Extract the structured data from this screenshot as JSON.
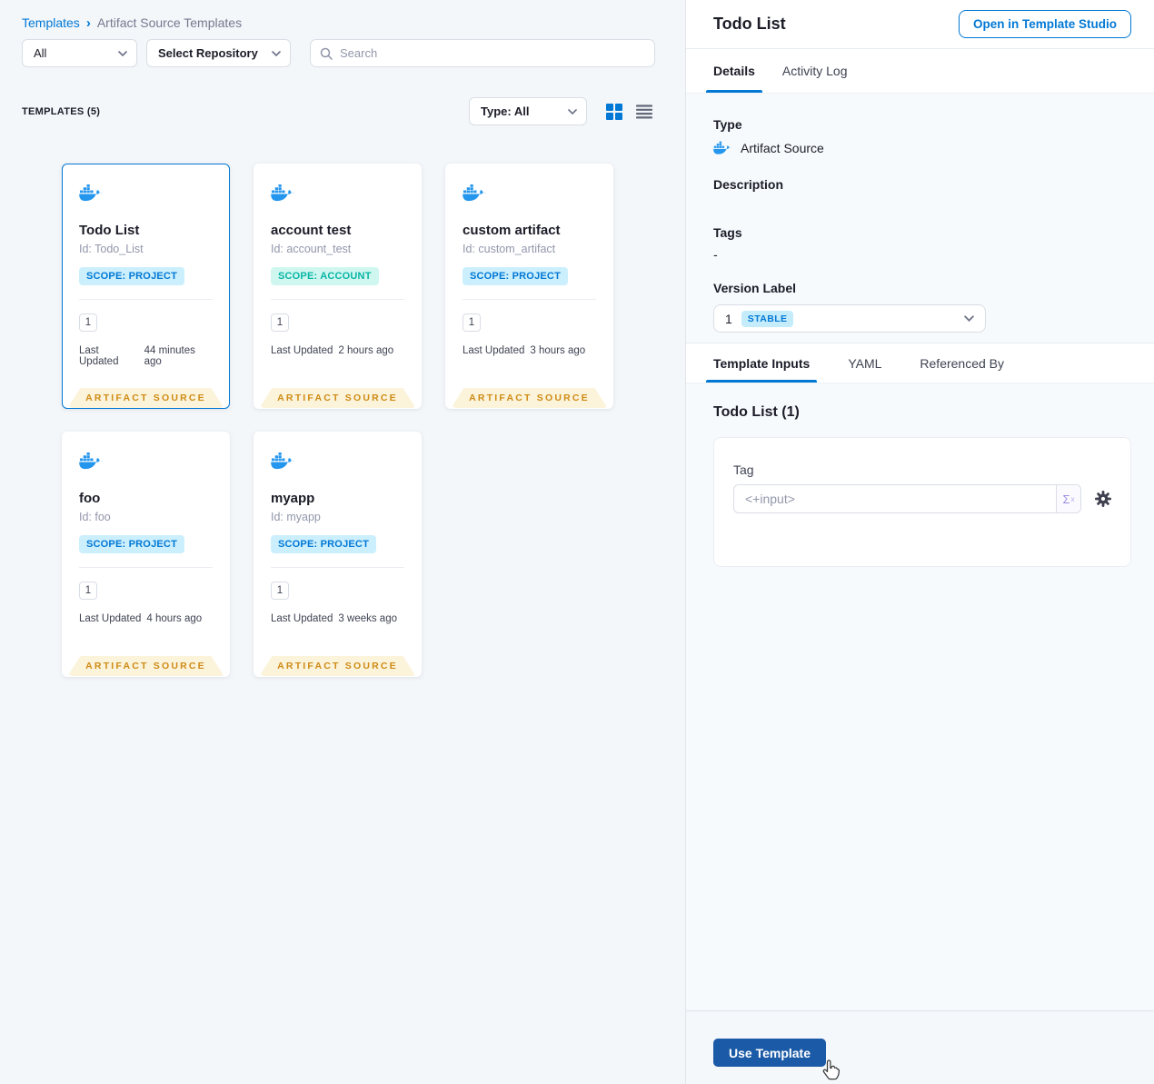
{
  "breadcrumb": {
    "root": "Templates",
    "separator": "›",
    "current": "Artifact Source Templates"
  },
  "filters": {
    "scope": "All",
    "repository": "Select Repository",
    "search_placeholder": "Search"
  },
  "toolbar": {
    "count": "TEMPLATES (5)",
    "type_filter": "Type: All"
  },
  "labels": {
    "last_updated": "Last Updated"
  },
  "cards": [
    {
      "title": "Todo List",
      "id": "Id: Todo_List",
      "scope": "SCOPE: PROJECT",
      "version": "1",
      "updated": "44 minutes ago",
      "type_ribbon": "ARTIFACT SOURCE"
    },
    {
      "title": "account test",
      "id": "Id: account_test",
      "scope": "SCOPE: ACCOUNT",
      "version": "1",
      "updated": "2 hours ago",
      "type_ribbon": "ARTIFACT SOURCE"
    },
    {
      "title": "custom artifact",
      "id": "Id: custom_artifact",
      "scope": "SCOPE: PROJECT",
      "version": "1",
      "updated": "3 hours ago",
      "type_ribbon": "ARTIFACT SOURCE"
    },
    {
      "title": "foo",
      "id": "Id: foo",
      "scope": "SCOPE: PROJECT",
      "version": "1",
      "updated": "4 hours ago",
      "type_ribbon": "ARTIFACT SOURCE"
    },
    {
      "title": "myapp",
      "id": "Id: myapp",
      "scope": "SCOPE: PROJECT",
      "version": "1",
      "updated": "3 weeks ago",
      "type_ribbon": "ARTIFACT SOURCE"
    }
  ],
  "panel": {
    "title": "Todo List",
    "open_button": "Open in Template Studio",
    "tabs": {
      "details": "Details",
      "activity": "Activity Log"
    },
    "fields": {
      "type_label": "Type",
      "type_value": "Artifact Source",
      "description_label": "Description",
      "tags_label": "Tags",
      "tags_value": "-",
      "version_label": "Version Label",
      "version_value": "1",
      "version_badge": "STABLE"
    },
    "input_tabs": {
      "inputs": "Template Inputs",
      "yaml": "YAML",
      "referenced": "Referenced By"
    },
    "inputs": {
      "heading": "Todo List (1)",
      "tag_label": "Tag",
      "tag_value": "<+input>",
      "expression_symbol": "Σ",
      "expression_sup": "x"
    },
    "footer": {
      "use_template": "Use Template"
    }
  },
  "colors": {
    "primary_blue": "#0278d5",
    "docker_blue": "#2496ED",
    "use_template_button": "#1b5aa6",
    "ribbon_text": "#cf8b15",
    "ribbon_bg": "#fbf3da",
    "scope_project_text": "#0278d5",
    "scope_account_text": "#0ab5a5",
    "stable_badge_bg": "#c5ecfb"
  }
}
